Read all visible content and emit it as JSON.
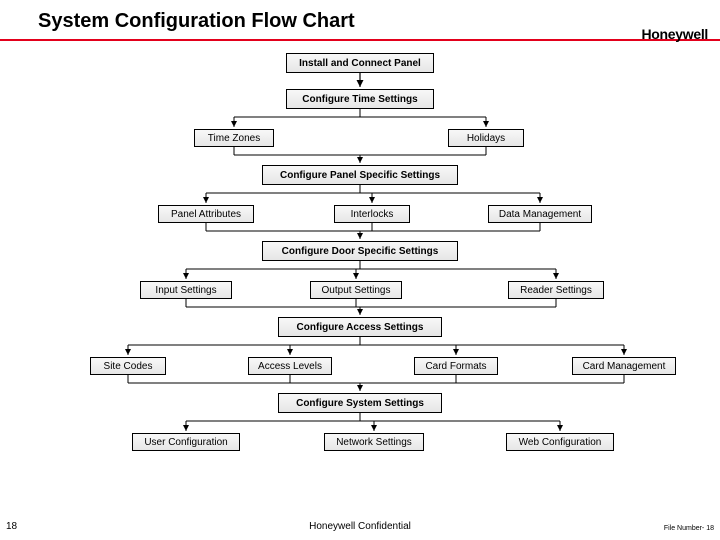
{
  "header": {
    "title": "System Configuration Flow Chart",
    "brand": "Honeywell"
  },
  "nodes": {
    "n1": "Install and Connect Panel",
    "n2": "Configure Time Settings",
    "n2a": "Time Zones",
    "n2b": "Holidays",
    "n3": "Configure Panel Specific Settings",
    "n3a": "Panel Attributes",
    "n3b": "Interlocks",
    "n3c": "Data Management",
    "n4": "Configure Door Specific Settings",
    "n4a": "Input Settings",
    "n4b": "Output Settings",
    "n4c": "Reader Settings",
    "n5": "Configure Access Settings",
    "n5a": "Site Codes",
    "n5b": "Access Levels",
    "n5c": "Card Formats",
    "n5d": "Card Management",
    "n6": "Configure System Settings",
    "n6a": "User Configuration",
    "n6b": "Network Settings",
    "n6c": "Web Configuration"
  },
  "footer": {
    "page_left": "18",
    "center": "Honeywell Confidential",
    "right": "File Number- 18"
  },
  "chart_data": {
    "type": "flowchart",
    "title": "System Configuration Flow Chart",
    "steps": [
      {
        "id": "n1",
        "label": "Install and Connect Panel",
        "kind": "step"
      },
      {
        "id": "n2",
        "label": "Configure Time Settings",
        "kind": "step",
        "children": [
          "Time Zones",
          "Holidays"
        ]
      },
      {
        "id": "n3",
        "label": "Configure Panel Specific Settings",
        "kind": "step",
        "children": [
          "Panel Attributes",
          "Interlocks",
          "Data Management"
        ]
      },
      {
        "id": "n4",
        "label": "Configure Door Specific Settings",
        "kind": "step",
        "children": [
          "Input Settings",
          "Output Settings",
          "Reader Settings"
        ]
      },
      {
        "id": "n5",
        "label": "Configure Access Settings",
        "kind": "step",
        "children": [
          "Site Codes",
          "Access Levels",
          "Card Formats",
          "Card Management"
        ]
      },
      {
        "id": "n6",
        "label": "Configure System Settings",
        "kind": "step",
        "children": [
          "User Configuration",
          "Network Settings",
          "Web Configuration"
        ]
      }
    ],
    "edges_main_sequence": [
      "n1",
      "n2",
      "n3",
      "n4",
      "n5",
      "n6"
    ]
  }
}
